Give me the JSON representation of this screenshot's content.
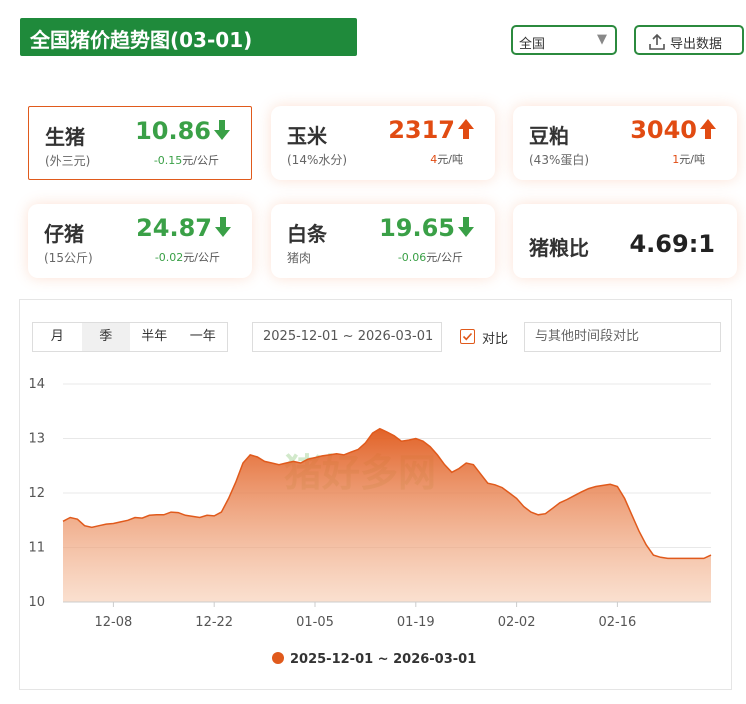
{
  "header": {
    "title": "全国猪价趋势图(03-01)",
    "region_label": "全国",
    "export_label": "导出数据"
  },
  "cards": [
    {
      "name": "生猪",
      "sub": "(外三元)",
      "price": "10.86",
      "trend": "down",
      "delta": "-0.15",
      "unit": "元/公斤"
    },
    {
      "name": "玉米",
      "sub": "(14%水分)",
      "price": "2317",
      "trend": "up",
      "delta": "4",
      "unit": "元/吨"
    },
    {
      "name": "豆粕",
      "sub": "(43%蛋白)",
      "price": "3040",
      "trend": "up",
      "delta": "1",
      "unit": "元/吨"
    },
    {
      "name": "仔猪",
      "sub": "(15公斤)",
      "price": "24.87",
      "trend": "down",
      "delta": "-0.02",
      "unit": "元/公斤"
    },
    {
      "name": "白条",
      "sub": "猪肉",
      "price": "19.65",
      "trend": "down",
      "delta": "-0.06",
      "unit": "元/公斤"
    }
  ],
  "ratio_card": {
    "name": "猪粮比",
    "value": "4.69:1"
  },
  "controls": {
    "periods": [
      "月",
      "季",
      "半年",
      "一年"
    ],
    "active_period": "季",
    "date_range": "2025-12-01 ~ 2026-03-01",
    "compare_label": "对比",
    "compare_placeholder": "与其他时间段对比"
  },
  "watermark": "猪好多网",
  "colors": {
    "brand_green": "#1f8a3b",
    "up_red": "#e14b12",
    "down_green": "#3aa047",
    "series": "#e05a1c"
  },
  "chart_data": {
    "type": "area",
    "ylim": [
      10,
      14
    ],
    "yticks": [
      10,
      11,
      12,
      13,
      14
    ],
    "xlim": [
      "2025-12-01",
      "2026-03-01"
    ],
    "xticks": [
      "12-08",
      "12-22",
      "01-05",
      "01-19",
      "02-02",
      "02-16"
    ],
    "legend": "2025-12-01 ~ 2026-03-01",
    "legend_position": "bottom",
    "grid": true,
    "series": [
      {
        "name": "2025-12-01 ~ 2026-03-01",
        "x": [
          "2025-12-01",
          "2025-12-02",
          "2025-12-03",
          "2025-12-04",
          "2025-12-05",
          "2025-12-06",
          "2025-12-07",
          "2025-12-08",
          "2025-12-09",
          "2025-12-10",
          "2025-12-11",
          "2025-12-12",
          "2025-12-13",
          "2025-12-14",
          "2025-12-15",
          "2025-12-16",
          "2025-12-17",
          "2025-12-18",
          "2025-12-19",
          "2025-12-20",
          "2025-12-21",
          "2025-12-22",
          "2025-12-23",
          "2025-12-24",
          "2025-12-25",
          "2025-12-26",
          "2025-12-27",
          "2025-12-28",
          "2025-12-29",
          "2025-12-30",
          "2025-12-31",
          "2026-01-01",
          "2026-01-02",
          "2026-01-03",
          "2026-01-04",
          "2026-01-05",
          "2026-01-06",
          "2026-01-07",
          "2026-01-08",
          "2026-01-09",
          "2026-01-10",
          "2026-01-11",
          "2026-01-12",
          "2026-01-13",
          "2026-01-14",
          "2026-01-15",
          "2026-01-16",
          "2026-01-17",
          "2026-01-18",
          "2026-01-19",
          "2026-01-20",
          "2026-01-21",
          "2026-01-22",
          "2026-01-23",
          "2026-01-24",
          "2026-01-25",
          "2026-01-26",
          "2026-01-27",
          "2026-01-28",
          "2026-01-29",
          "2026-01-30",
          "2026-01-31",
          "2026-02-01",
          "2026-02-02",
          "2026-02-03",
          "2026-02-04",
          "2026-02-05",
          "2026-02-06",
          "2026-02-07",
          "2026-02-08",
          "2026-02-09",
          "2026-02-10",
          "2026-02-11",
          "2026-02-12",
          "2026-02-13",
          "2026-02-14",
          "2026-02-15",
          "2026-02-16",
          "2026-02-17",
          "2026-02-18",
          "2026-02-19",
          "2026-02-20",
          "2026-02-21",
          "2026-02-22",
          "2026-02-23",
          "2026-02-24",
          "2026-02-25",
          "2026-02-26",
          "2026-02-27",
          "2026-02-28",
          "2026-03-01"
        ],
        "values": [
          11.48,
          11.55,
          11.52,
          11.4,
          11.37,
          11.4,
          11.43,
          11.44,
          11.47,
          11.5,
          11.55,
          11.54,
          11.59,
          11.6,
          11.6,
          11.65,
          11.64,
          11.59,
          11.57,
          11.55,
          11.59,
          11.58,
          11.65,
          11.9,
          12.2,
          12.55,
          12.7,
          12.66,
          12.58,
          12.55,
          12.52,
          12.55,
          12.58,
          12.55,
          12.62,
          12.65,
          12.68,
          12.7,
          12.72,
          12.7,
          12.75,
          12.8,
          12.92,
          13.1,
          13.18,
          13.12,
          13.05,
          12.95,
          12.97,
          13.0,
          12.95,
          12.85,
          12.7,
          12.52,
          12.38,
          12.45,
          12.55,
          12.52,
          12.35,
          12.18,
          12.15,
          12.1,
          12.0,
          11.9,
          11.75,
          11.65,
          11.6,
          11.62,
          11.72,
          11.82,
          11.88,
          11.95,
          12.02,
          12.08,
          12.12,
          12.14,
          12.16,
          12.12,
          11.9,
          11.6,
          11.3,
          11.05,
          10.86,
          10.82,
          10.8,
          10.8,
          10.8,
          10.8,
          10.8,
          10.8,
          10.86
        ]
      }
    ]
  }
}
